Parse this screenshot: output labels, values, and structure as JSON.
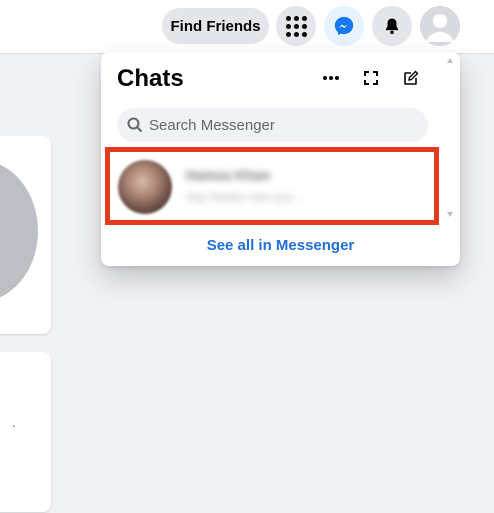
{
  "header": {
    "find_friends_label": "Find Friends"
  },
  "chats": {
    "title": "Chats",
    "search": {
      "placeholder": "Search Messenger",
      "value": ""
    },
    "conversation": {
      "name": "Hamza Khan",
      "preview": "Say thanks now you …"
    },
    "see_all_label": "See all in Messenger"
  },
  "icons": {
    "menu": "grid-menu-icon",
    "messenger": "messenger-icon",
    "notifications": "bell-icon",
    "profile": "profile-avatar-icon",
    "more": "more-options-icon",
    "expand": "expand-icon",
    "compose": "compose-icon",
    "search": "search-icon"
  },
  "colors": {
    "accent": "#1877f2",
    "highlight_border": "#e23b20",
    "link": "#216fdb",
    "page_background": "#f0f2f5"
  }
}
